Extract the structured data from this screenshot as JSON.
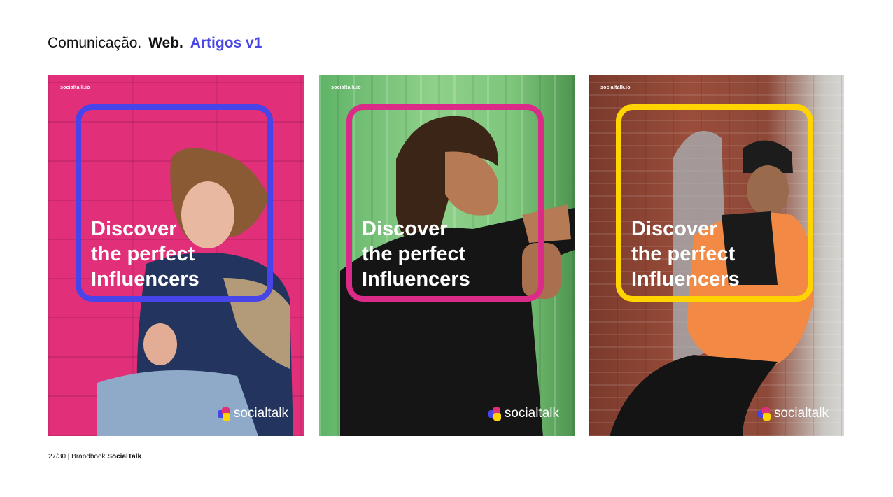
{
  "title": {
    "part1": "Comunicação.",
    "part2": "Web.",
    "part3": "Artigos v1",
    "accent_color": "#4a46e6"
  },
  "cards": [
    {
      "site_label": "socialtalk.io",
      "headline": [
        "Discover",
        "the perfect",
        "Influencers"
      ],
      "frame_color": "#4744ea",
      "background_color": "#e12f79",
      "photo_subject": "woman with short brown hair against pink brick wall",
      "logo_text": "socialtalk"
    },
    {
      "site_label": "socialtalk.io",
      "headline": [
        "Discover",
        "the perfect",
        "Influencers"
      ],
      "frame_color": "#db2a87",
      "background_color": "#7ec77c",
      "photo_subject": "man with dreadlocks in black shirt against green wall",
      "logo_text": "socialtalk"
    },
    {
      "site_label": "socialtalk.io",
      "headline": [
        "Discover",
        "the perfect",
        "Influencers"
      ],
      "frame_color": "#ffd400",
      "background_color": "#8d4838",
      "photo_subject": "man in beanie and orange puffer jacket by brick building",
      "logo_text": "socialtalk"
    }
  ],
  "logo_colors": [
    "#4744ea",
    "#e12f79",
    "#ffd400"
  ],
  "footer": {
    "page": "27/30 | Brandbook",
    "brand": "SocialTalk"
  }
}
